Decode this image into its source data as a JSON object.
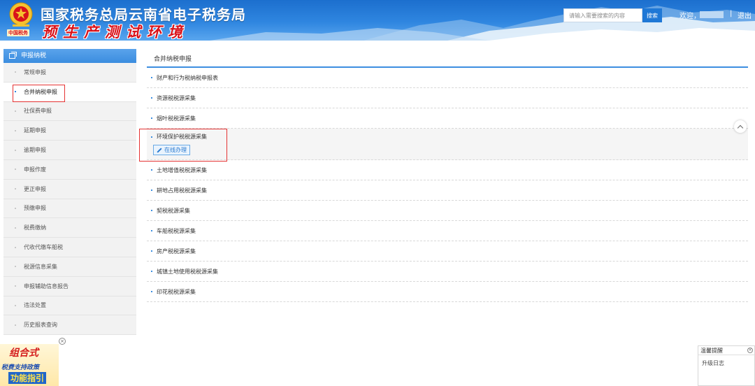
{
  "header": {
    "title": "国家税务总局云南省电子税务局",
    "subtitle": "预生产测试环境",
    "emblem_caption": "中国税务",
    "search_placeholder": "请输入需要搜索的内容",
    "search_button": "搜索",
    "welcome": "欢迎，",
    "separator": "|",
    "logout": "退出"
  },
  "sidebar": {
    "heading": "申报纳税",
    "items": [
      {
        "label": "常规申报"
      },
      {
        "label": "合并纳税申报"
      },
      {
        "label": "社保费申报"
      },
      {
        "label": "延期申报"
      },
      {
        "label": "逾期申报"
      },
      {
        "label": "申报作废"
      },
      {
        "label": "更正申报"
      },
      {
        "label": "预缴申报"
      },
      {
        "label": "税费缴纳"
      },
      {
        "label": "代收代缴车船税"
      },
      {
        "label": "税源信息采集"
      },
      {
        "label": "申报辅助信息报告"
      },
      {
        "label": "违法处置"
      },
      {
        "label": "历史报表查询"
      }
    ]
  },
  "main": {
    "title": "合并纳税申报",
    "rows": [
      {
        "label": "财产和行为税纳税申报表"
      },
      {
        "label": "资源税税源采集"
      },
      {
        "label": "烟叶税税源采集"
      },
      {
        "label": "环境保护税税源采集",
        "action": "在线办理"
      },
      {
        "label": "土地增值税税源采集"
      },
      {
        "label": "耕地占用税税源采集"
      },
      {
        "label": "契税税源采集"
      },
      {
        "label": "车船税税源采集"
      },
      {
        "label": "房产税税源采集"
      },
      {
        "label": "城镇土地使用税税源采集"
      },
      {
        "label": "印花税税源采集"
      }
    ]
  },
  "promo": {
    "line1": "组合式",
    "line2": "税费支持政策",
    "line3": "功能指引",
    "close": "×"
  },
  "notice": {
    "title": "温馨提醒",
    "close": "×",
    "body": "升级日志"
  },
  "colors": {
    "primary": "#2f86e0",
    "header_dark": "#1c6fce",
    "highlight_red": "#e53333"
  }
}
